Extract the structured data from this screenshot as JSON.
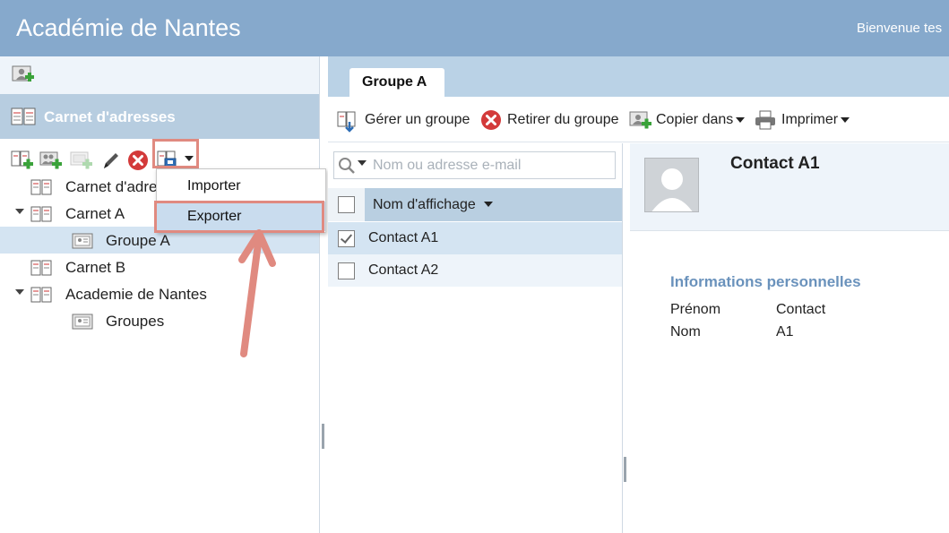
{
  "header": {
    "title": "Académie de Nantes",
    "welcome": "Bienvenue tes"
  },
  "addressbook": {
    "section_title": "Carnet d'adresses",
    "tree": [
      {
        "label": "Carnet d'adre",
        "type": "book",
        "expanded": false,
        "level": 0
      },
      {
        "label": "Carnet A",
        "type": "book",
        "expanded": true,
        "level": 0
      },
      {
        "label": "Groupe A",
        "type": "group",
        "level": 1,
        "selected": true
      },
      {
        "label": "Carnet B",
        "type": "book",
        "expanded": false,
        "level": 0
      },
      {
        "label": "Academie de Nantes",
        "type": "book",
        "expanded": true,
        "level": 0
      },
      {
        "label": "Groupes",
        "type": "group",
        "level": 1
      }
    ]
  },
  "menu": {
    "items": [
      {
        "label": "Importer",
        "highlighted": false
      },
      {
        "label": "Exporter",
        "highlighted": true
      }
    ]
  },
  "tabs": [
    {
      "label": "Groupe A",
      "active": true
    }
  ],
  "toolbar": {
    "manage_group": "Gérer un groupe",
    "remove_from_group": "Retirer du groupe",
    "copy_to": "Copier dans",
    "print": "Imprimer"
  },
  "contacts": {
    "search_placeholder": "Nom ou adresse e-mail",
    "column_header": "Nom d'affichage",
    "rows": [
      {
        "name": "Contact A1",
        "checked": true,
        "selected": true
      },
      {
        "name": "Contact A2",
        "checked": false,
        "selected": false
      }
    ]
  },
  "detail": {
    "name": "Contact A1",
    "section": "Informations personnelles",
    "fields": [
      {
        "label": "Prénom",
        "value": "Contact"
      },
      {
        "label": "Nom",
        "value": "A1"
      }
    ]
  },
  "colors": {
    "header": "#86a9cc",
    "accent_light": "#d4e4f2",
    "annotation": "#e08a80",
    "section_text": "#6a92bc"
  }
}
